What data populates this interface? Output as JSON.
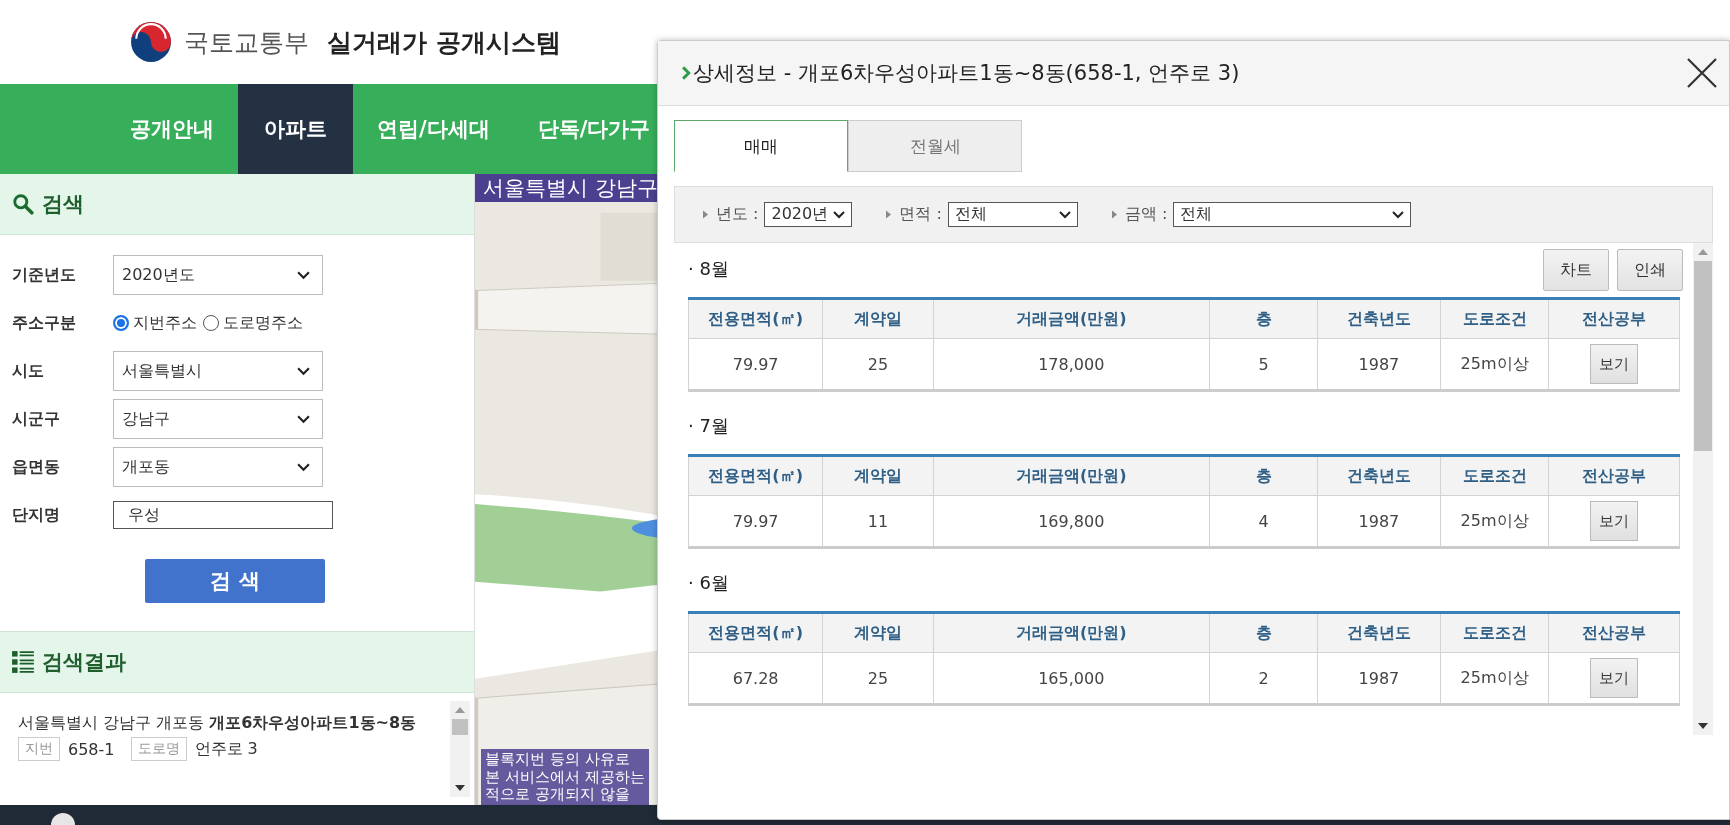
{
  "header": {
    "ministry": "국토교통부",
    "system_title": "실거래가 공개시스템"
  },
  "nav": [
    {
      "label": "공개안내",
      "selected": false
    },
    {
      "label": "아파트",
      "selected": true
    },
    {
      "label": "연립/다세대",
      "selected": false
    },
    {
      "label": "단독/다가구",
      "selected": false
    }
  ],
  "search": {
    "title": "검색",
    "fields": [
      {
        "kind": "select",
        "label": "기준년도",
        "value": "2020년도"
      },
      {
        "kind": "radio",
        "label": "주소구분",
        "options": [
          {
            "label": "지번주소",
            "selected": true
          },
          {
            "label": "도로명주소",
            "selected": false
          }
        ]
      },
      {
        "kind": "select",
        "label": "시도",
        "value": "서울특별시"
      },
      {
        "kind": "select",
        "label": "시군구",
        "value": "강남구"
      },
      {
        "kind": "select",
        "label": "읍면동",
        "value": "개포동"
      },
      {
        "kind": "text",
        "label": "단지명",
        "value": "우성"
      }
    ],
    "button": "검 색"
  },
  "results": {
    "title": "검색결과",
    "items": [
      {
        "text": "서울특별시 강남구 개포동 **개포6차우성아파트1동~8동**",
        "lot_tag": "지번",
        "lot": "658-1",
        "road_tag": "도로명",
        "road": "언주로 3"
      }
    ]
  },
  "map": {
    "region_banner": "서울특별시 강남구",
    "notice_lines": [
      "블록지번 등의 사유로",
      "본 서비스에서 제공하는",
      "적으로 공개되지 않을"
    ]
  },
  "modal": {
    "title": "상세정보 - 개포6차우성아파트1동~8동(658-1, 언주로 3)",
    "tabs": [
      {
        "label": "매매",
        "selected": true
      },
      {
        "label": "전월세",
        "selected": false
      }
    ],
    "filters": [
      {
        "label": "년도 :",
        "value": "2020년"
      },
      {
        "label": "면적 :",
        "value": "전체"
      },
      {
        "label": "금액 :",
        "value": "전체"
      }
    ],
    "actions": [
      "차트",
      "인쇄"
    ],
    "months": [
      {
        "title": "· 8월",
        "columns": [
          "전용면적(㎡)",
          "계약일",
          "거래금액(만원)",
          "층",
          "건축년도",
          "도로조건",
          "전산공부"
        ],
        "rows": [
          {
            "cells": [
              "79.97",
              "25",
              "178,000",
              "5",
              "1987",
              "25m이상"
            ],
            "button": "보기"
          }
        ]
      },
      {
        "title": "· 7월",
        "columns": [
          "전용면적(㎡)",
          "계약일",
          "거래금액(만원)",
          "층",
          "건축년도",
          "도로조건",
          "전산공부"
        ],
        "rows": [
          {
            "cells": [
              "79.97",
              "11",
              "169,800",
              "4",
              "1987",
              "25m이상"
            ],
            "button": "보기"
          }
        ]
      },
      {
        "title": "· 6월",
        "columns": [
          "전용면적(㎡)",
          "계약일",
          "거래금액(만원)",
          "층",
          "건축년도",
          "도로조건",
          "전산공부"
        ],
        "rows": [
          {
            "cells": [
              "67.28",
              "25",
              "165,000",
              "2",
              "1987",
              "25m이상"
            ],
            "button": "보기"
          }
        ]
      }
    ]
  }
}
